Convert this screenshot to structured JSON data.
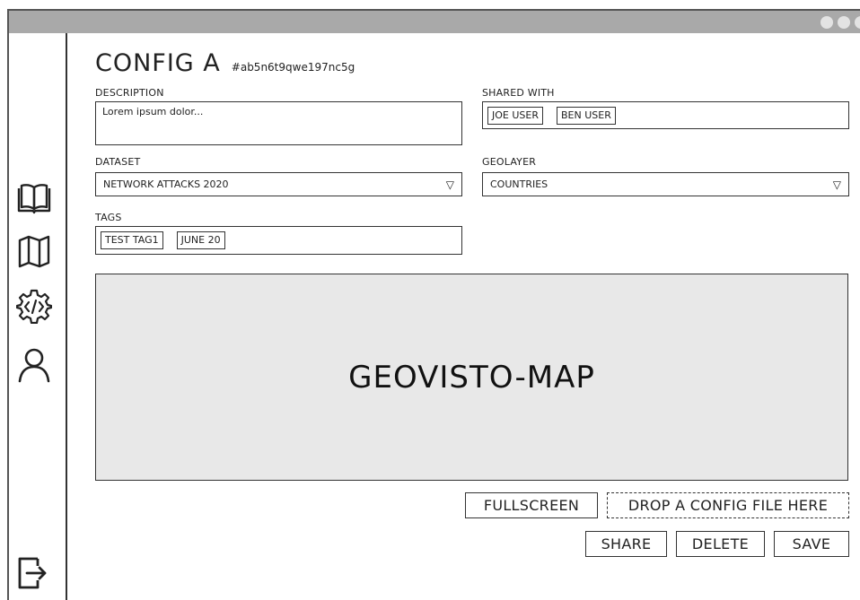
{
  "window": {
    "controls": [
      "dot",
      "dot",
      "dot"
    ]
  },
  "sidebar": {
    "items": [
      {
        "icon": "book-icon"
      },
      {
        "icon": "map-icon"
      },
      {
        "icon": "code-gear-icon"
      },
      {
        "icon": "user-icon"
      }
    ],
    "bottom": {
      "icon": "logout-icon"
    }
  },
  "config": {
    "title": "CONFIG A",
    "hash": "#ab5n6t9qwe197nc5g"
  },
  "description": {
    "label": "DESCRIPTION",
    "value": "Lorem ipsum dolor..."
  },
  "shared_with": {
    "label": "SHARED WITH",
    "users": [
      "JOE USER",
      "BEN USER"
    ]
  },
  "dataset": {
    "label": "DATASET",
    "value": "NETWORK ATTACKS 2020"
  },
  "geolayer": {
    "label": "GEOLAYER",
    "value": "COUNTRIES"
  },
  "tags": {
    "label": "TAGS",
    "items": [
      "TEST TAG1",
      "JUNE 20"
    ]
  },
  "map": {
    "label": "GEOVISTO-MAP",
    "background": "#e8e8e8"
  },
  "actions": {
    "fullscreen": "FULLSCREEN",
    "drop": "DROP A CONFIG FILE HERE",
    "share": "SHARE",
    "delete": "DELETE",
    "save": "SAVE"
  }
}
